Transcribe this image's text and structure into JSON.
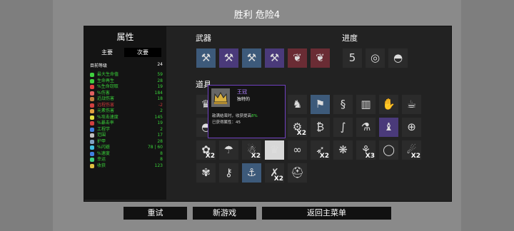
{
  "title": "胜利  危险4",
  "stats_panel": {
    "title": "属性",
    "tab_main": "主要",
    "tab_secondary": "次要",
    "level_label": "目前等级",
    "level_value": "24",
    "stats": [
      {
        "label": "最大生命值",
        "value": "59",
        "color": "#3ad23a"
      },
      {
        "label": "生命再生",
        "value": "28",
        "color": "#3ad23a"
      },
      {
        "label": "%生命窃取",
        "value": "19",
        "color": "#3ad23a"
      },
      {
        "label": "%伤害",
        "value": "184",
        "color": "#3ad23a"
      },
      {
        "label": "近战伤害",
        "value": "18",
        "color": "#3ad23a"
      },
      {
        "label": "远程伤害",
        "value": "-2",
        "color": "#d03a3a"
      },
      {
        "label": "元素伤害",
        "value": "2",
        "color": "#3ad23a"
      },
      {
        "label": "%攻击速度",
        "value": "145",
        "color": "#3ad23a"
      },
      {
        "label": "%暴击率",
        "value": "19",
        "color": "#3ad23a"
      },
      {
        "label": "工程学",
        "value": "2",
        "color": "#3ad23a"
      },
      {
        "label": "范围",
        "value": "17",
        "color": "#3ad23a"
      },
      {
        "label": "护甲",
        "value": "28",
        "color": "#3ad23a"
      },
      {
        "label": "%闪避",
        "value": "78 | 60",
        "color": "#3ad23a"
      },
      {
        "label": "%速度",
        "value": "8",
        "color": "#3ad23a"
      },
      {
        "label": "幸运",
        "value": "8",
        "color": "#3ad23a"
      },
      {
        "label": "收获",
        "value": "123",
        "color": "#3ad23a"
      }
    ]
  },
  "weapons_label": "武器",
  "progress_label": "进度",
  "items_label": "道具",
  "tooltip": {
    "name": "王冠",
    "rarity": "独特的",
    "desc_pre": "敌满结束时，收获提高",
    "desc_hl": "8%",
    "count_text": "已获得属性：45"
  },
  "weapons": [
    {
      "icon": "axe-icon",
      "tier": "blue",
      "glyph": "⚒"
    },
    {
      "icon": "axe-icon",
      "tier": "purple",
      "glyph": "⚒"
    },
    {
      "icon": "axe-icon",
      "tier": "blue",
      "glyph": "⚒"
    },
    {
      "icon": "axe-icon",
      "tier": "purple",
      "glyph": "⚒"
    },
    {
      "icon": "leaf-blade-icon",
      "tier": "red",
      "glyph": "❦"
    },
    {
      "icon": "leaf-blade-icon",
      "tier": "red",
      "glyph": "❦"
    }
  ],
  "progress": [
    {
      "icon": "danger-five-icon",
      "glyph": "5"
    },
    {
      "icon": "ring-icon",
      "glyph": "◎"
    },
    {
      "icon": "egg-character-icon",
      "glyph": "◓"
    }
  ],
  "items": [
    {
      "icon": "crown-icon",
      "tier": "dark",
      "glyph": "♛",
      "count": ""
    },
    {
      "icon": "scroll-icon",
      "tier": "dark",
      "glyph": "✉",
      "count": ""
    },
    {
      "icon": "spider-icon",
      "tier": "dark",
      "glyph": "✱",
      "count": ""
    },
    {
      "icon": "grenade-icon",
      "tier": "dark",
      "glyph": "●",
      "count": ""
    },
    {
      "icon": "rabbit-icon",
      "tier": "dark",
      "glyph": "♞",
      "count": ""
    },
    {
      "icon": "flag-icon",
      "tier": "blue",
      "glyph": "⚑",
      "count": ""
    },
    {
      "icon": "squid-icon",
      "tier": "dark",
      "glyph": "§",
      "count": ""
    },
    {
      "icon": "bucket-icon",
      "tier": "dark",
      "glyph": "▥",
      "count": ""
    },
    {
      "icon": "claw-icon",
      "tier": "dark",
      "glyph": "✋",
      "count": ""
    },
    {
      "icon": "cup-icon",
      "tier": "dark",
      "glyph": "☕",
      "count": ""
    },
    {
      "icon": "egg-icon",
      "tier": "dark",
      "glyph": "◓",
      "count": ""
    },
    {
      "icon": "hat-icon",
      "tier": "dark",
      "glyph": "♜",
      "count": ""
    },
    {
      "icon": "cloud-icon",
      "tier": "dark",
      "glyph": "☁",
      "count": ""
    },
    {
      "icon": "bone-icon",
      "tier": "dark",
      "glyph": "☠",
      "count": ""
    },
    {
      "icon": "cannon-icon",
      "tier": "dark",
      "glyph": "⚙",
      "count": "X2"
    },
    {
      "icon": "cash-icon",
      "tier": "dark",
      "glyph": "₿",
      "count": ""
    },
    {
      "icon": "tentacle-icon",
      "tier": "dark",
      "glyph": "∫",
      "count": ""
    },
    {
      "icon": "potion-icon",
      "tier": "dark",
      "glyph": "⚗",
      "count": ""
    },
    {
      "icon": "candle-icon",
      "tier": "purple",
      "glyph": "♝",
      "count": ""
    },
    {
      "icon": "ufo-icon",
      "tier": "dark",
      "glyph": "⊕",
      "count": ""
    },
    {
      "icon": "gear-icon",
      "tier": "dark",
      "glyph": "✿",
      "count": "X2"
    },
    {
      "icon": "blob-icon",
      "tier": "dark",
      "glyph": "☂",
      "count": ""
    },
    {
      "icon": "snowman-icon",
      "tier": "dark",
      "glyph": "☃",
      "count": "X2"
    },
    {
      "icon": "crown-icon",
      "tier": "white",
      "glyph": "♛",
      "count": ""
    },
    {
      "icon": "coil-icon",
      "tier": "dark",
      "glyph": "∞",
      "count": ""
    },
    {
      "icon": "feather-icon",
      "tier": "dark",
      "glyph": "➶",
      "count": "X2"
    },
    {
      "icon": "vortex-icon",
      "tier": "dark",
      "glyph": "❋",
      "count": ""
    },
    {
      "icon": "pod-icon",
      "tier": "dark",
      "glyph": "⚘",
      "count": "X3"
    },
    {
      "icon": "ring-icon",
      "tier": "dark",
      "glyph": "◯",
      "count": ""
    },
    {
      "icon": "ghost-icon",
      "tier": "dark",
      "glyph": "☄",
      "count": "X2"
    },
    {
      "icon": "flower-icon",
      "tier": "dark",
      "glyph": "✾",
      "count": ""
    },
    {
      "icon": "syringe-icon",
      "tier": "dark",
      "glyph": "⚷",
      "count": ""
    },
    {
      "icon": "hook-icon",
      "tier": "blue",
      "glyph": "⚓",
      "count": ""
    },
    {
      "icon": "dagger-icon",
      "tier": "dark",
      "glyph": "✗",
      "count": "X2"
    },
    {
      "icon": "helmet-icon",
      "tier": "dark",
      "glyph": "⛑",
      "count": ""
    }
  ],
  "buttons": {
    "retry": "重试",
    "new_game": "新游戏",
    "main_menu": "返回主菜单"
  }
}
